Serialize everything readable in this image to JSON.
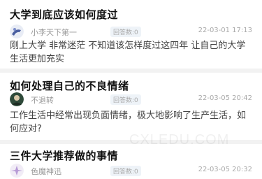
{
  "posts": [
    {
      "title": "大学到底应该如何度过",
      "author": "小李天下第一",
      "answers": "回答数:0",
      "time": "22-03-01 17:13",
      "content": "刚上大学 非常迷茫 不知道该怎样度过这四年 让自己的大学生活更加充实"
    },
    {
      "title": "如何处理自己的不良情绪",
      "author": "不退转",
      "answers": "回答数:0",
      "time": "22-03-05 20:42",
      "content": "工作生活中经常出现负面情绪，极大地影响了生产生活，如何应对?"
    },
    {
      "title": "三件大学推荐做的事情",
      "author": "色魔神迅",
      "answers": "回答数:0",
      "time": "22-03-05 20:32",
      "content": ""
    }
  ],
  "watermark": "CXLEDU.COM"
}
